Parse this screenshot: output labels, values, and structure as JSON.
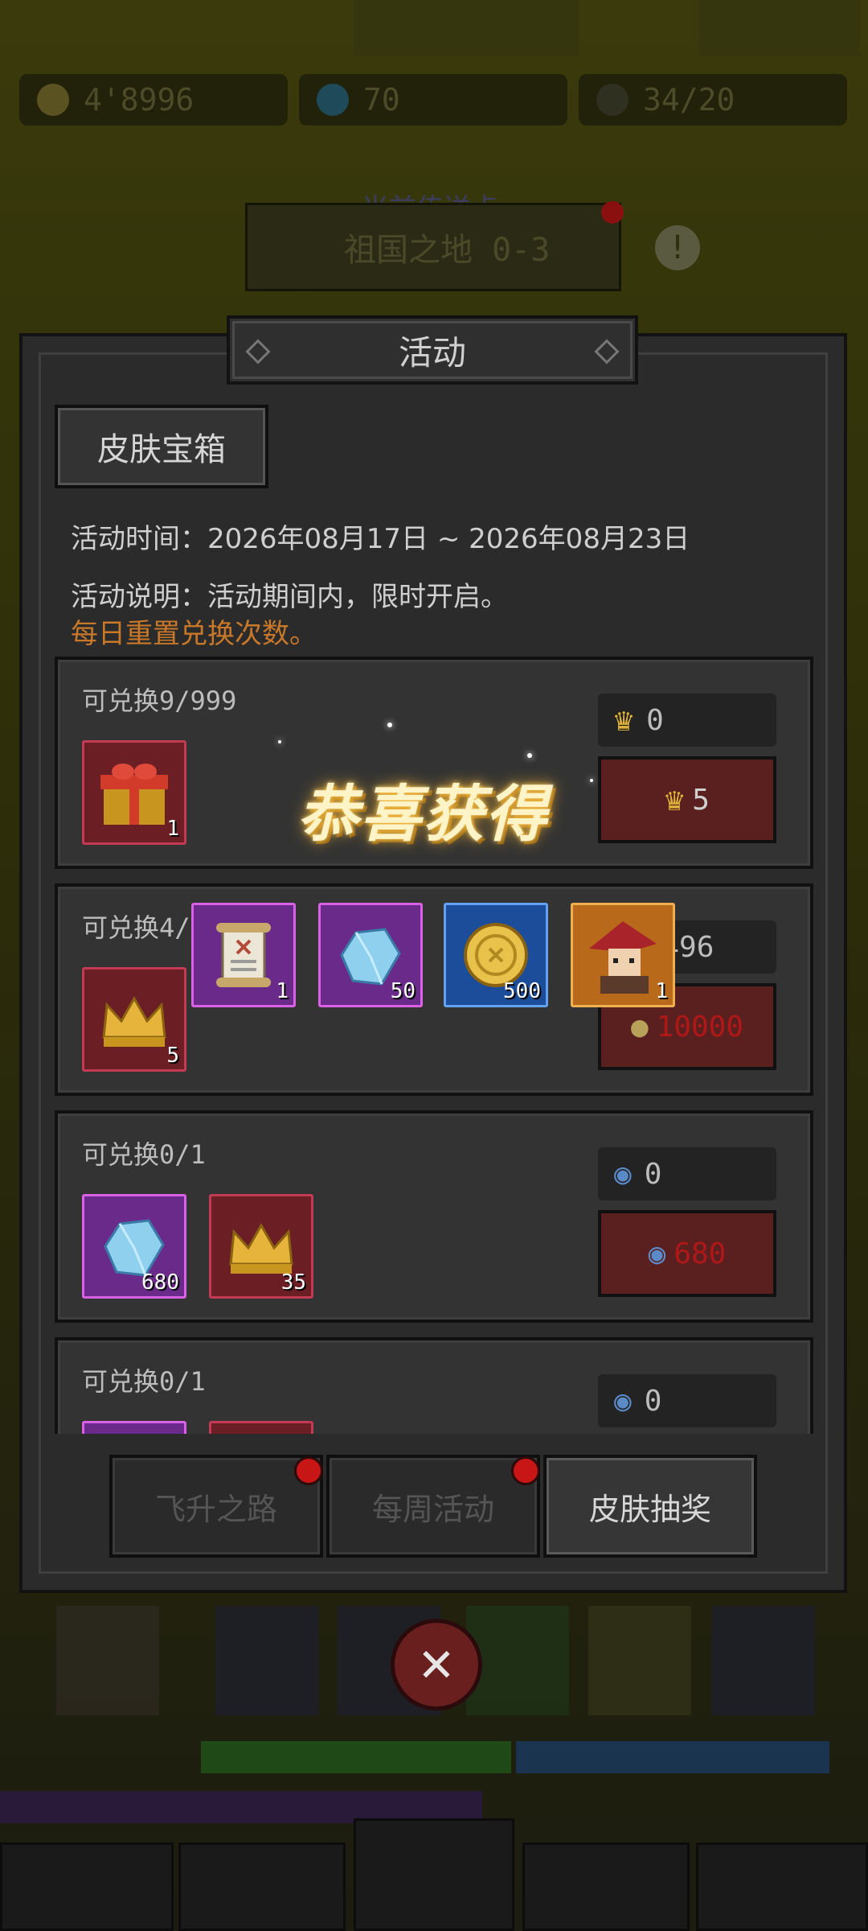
{
  "hud": {
    "gold": "4'8996",
    "crystal": "70",
    "stamina": "34/20",
    "portal_caption": "当前传送点",
    "portal_name": "祖国之地 0-3"
  },
  "dialog": {
    "title": "活动",
    "section_tab": "皮肤宝箱",
    "time_line": "活动时间：2026年08月17日 ~ 2026年08月23日",
    "desc_line": "活动说明：活动期间内，限时开启。",
    "reset_note": "每日重置兑换次数。"
  },
  "cards": [
    {
      "limit": "可兑换9/999",
      "item_count": "1",
      "owned": "0",
      "cost": "5"
    },
    {
      "limit": "可兑换4/",
      "item_count": "5",
      "owned": "9496",
      "cost": "10000"
    },
    {
      "limit": "可兑换0/1",
      "items": [
        {
          "count": "680"
        },
        {
          "count": "35"
        }
      ],
      "owned": "0",
      "cost": "680"
    },
    {
      "limit": "可兑换0/1",
      "owned": "0"
    }
  ],
  "bottom_tabs": [
    "飞升之路",
    "每周活动",
    "皮肤抽奖"
  ],
  "popup": {
    "title": "恭喜获得",
    "rewards": [
      {
        "icon": "scroll",
        "count": "1"
      },
      {
        "icon": "crystal",
        "count": "50"
      },
      {
        "icon": "gold-coin",
        "count": "500"
      },
      {
        "icon": "hero-portrait",
        "count": "1"
      }
    ]
  }
}
